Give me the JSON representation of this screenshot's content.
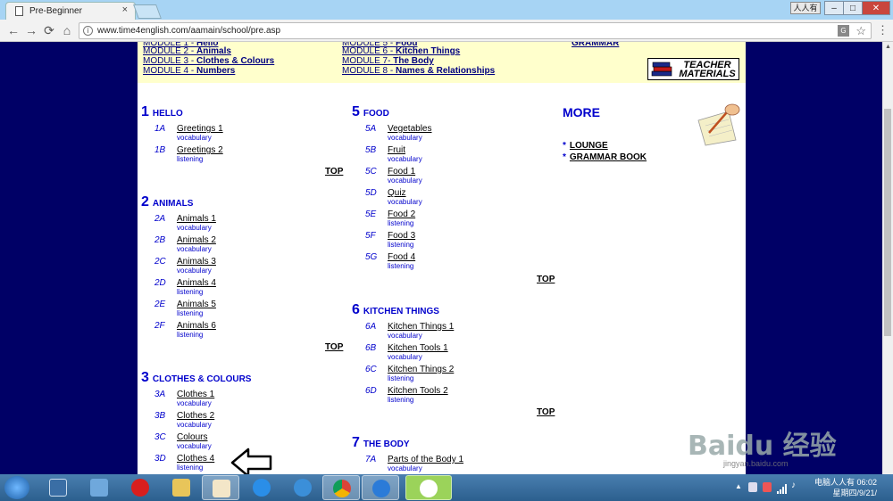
{
  "browser": {
    "tab_title": "Pre-Beginner",
    "tab_close": "×",
    "user_label": "人人有",
    "min": "–",
    "max": "□",
    "close": "✕",
    "back": "←",
    "forward": "→",
    "reload": "⟳",
    "home": "⌂",
    "url": "www.time4english.com/aamain/school/pre.asp",
    "info": "i",
    "translate": "G",
    "star": "☆",
    "menu": "⋮"
  },
  "modules": {
    "col1": [
      {
        "prefix": "MODULE 2 - ",
        "name": "Animals"
      },
      {
        "prefix": "MODULE 3 - ",
        "name": "Clothes & Colours"
      },
      {
        "prefix": "MODULE 4 - ",
        "name": "Numbers"
      }
    ],
    "col2": [
      {
        "prefix": "MODULE 6 - ",
        "name": "Kitchen Things"
      },
      {
        "prefix": "MODULE 7- ",
        "name": "The Body"
      },
      {
        "prefix": "MODULE 8 - ",
        "name": "Names & Relationships"
      }
    ],
    "teacher_label": "TEACHER MATERIALS"
  },
  "sections": {
    "s1": {
      "num": "1",
      "title": "HELLO",
      "lessons": [
        {
          "code": "1A",
          "title": "Greetings 1",
          "type": "vocabulary"
        },
        {
          "code": "1B",
          "title": "Greetings 2",
          "type": "listening"
        }
      ]
    },
    "s2": {
      "num": "2",
      "title": "ANIMALS",
      "lessons": [
        {
          "code": "2A",
          "title": "Animals 1",
          "type": "vocabulary"
        },
        {
          "code": "2B",
          "title": "Animals 2",
          "type": "vocabulary"
        },
        {
          "code": "2C",
          "title": "Animals 3",
          "type": "vocabulary"
        },
        {
          "code": "2D",
          "title": "Animals 4",
          "type": "listening"
        },
        {
          "code": "2E",
          "title": "Animals 5",
          "type": "listening"
        },
        {
          "code": "2F",
          "title": "Animals 6",
          "type": "listening"
        }
      ]
    },
    "s3": {
      "num": "3",
      "title": "CLOTHES & COLOURS",
      "lessons": [
        {
          "code": "3A",
          "title": "Clothes 1",
          "type": "vocabulary"
        },
        {
          "code": "3B",
          "title": "Clothes 2",
          "type": "vocabulary"
        },
        {
          "code": "3C",
          "title": "Colours",
          "type": "vocabulary"
        },
        {
          "code": "3D",
          "title": "Clothes 4",
          "type": "listening"
        }
      ]
    },
    "s5": {
      "num": "5",
      "title": "FOOD",
      "lessons": [
        {
          "code": "5A",
          "title": "Vegetables",
          "type": "vocabulary"
        },
        {
          "code": "5B",
          "title": "Fruit",
          "type": "vocabulary"
        },
        {
          "code": "5C",
          "title": "Food 1",
          "type": "vocabulary"
        },
        {
          "code": "5D",
          "title": "Quiz",
          "type": "vocabulary"
        },
        {
          "code": "5E",
          "title": "Food 2",
          "type": "listening"
        },
        {
          "code": "5F",
          "title": "Food 3",
          "type": "listening"
        },
        {
          "code": "5G",
          "title": "Food 4",
          "type": "listening"
        }
      ]
    },
    "s6": {
      "num": "6",
      "title": "KITCHEN THINGS",
      "lessons": [
        {
          "code": "6A",
          "title": "Kitchen Things 1",
          "type": "vocabulary"
        },
        {
          "code": "6B",
          "title": "Kitchen Tools 1",
          "type": "vocabulary"
        },
        {
          "code": "6C",
          "title": "Kitchen Things 2",
          "type": "listening"
        },
        {
          "code": "6D",
          "title": "Kitchen Tools 2",
          "type": "listening"
        }
      ]
    },
    "s7": {
      "num": "7",
      "title": "THE BODY",
      "lessons": [
        {
          "code": "7A",
          "title": "Parts of the Body 1",
          "type": "vocabulary"
        }
      ]
    }
  },
  "top_label": "TOP",
  "more": {
    "title": "MORE",
    "links": [
      "LOUNGE",
      "GRAMMAR BOOK"
    ],
    "bullet": "*"
  },
  "taskbar": {
    "clock_line1": "电脑人人有 06:02",
    "clock_line2": "星期四/9/21/"
  },
  "watermark": {
    "text": "Baidu 经验",
    "sub": "jingyan.baidu.com"
  },
  "colors": {
    "page_bg": "#000066",
    "section_blue": "#0000cc",
    "module_bg": "#ffffcc"
  }
}
